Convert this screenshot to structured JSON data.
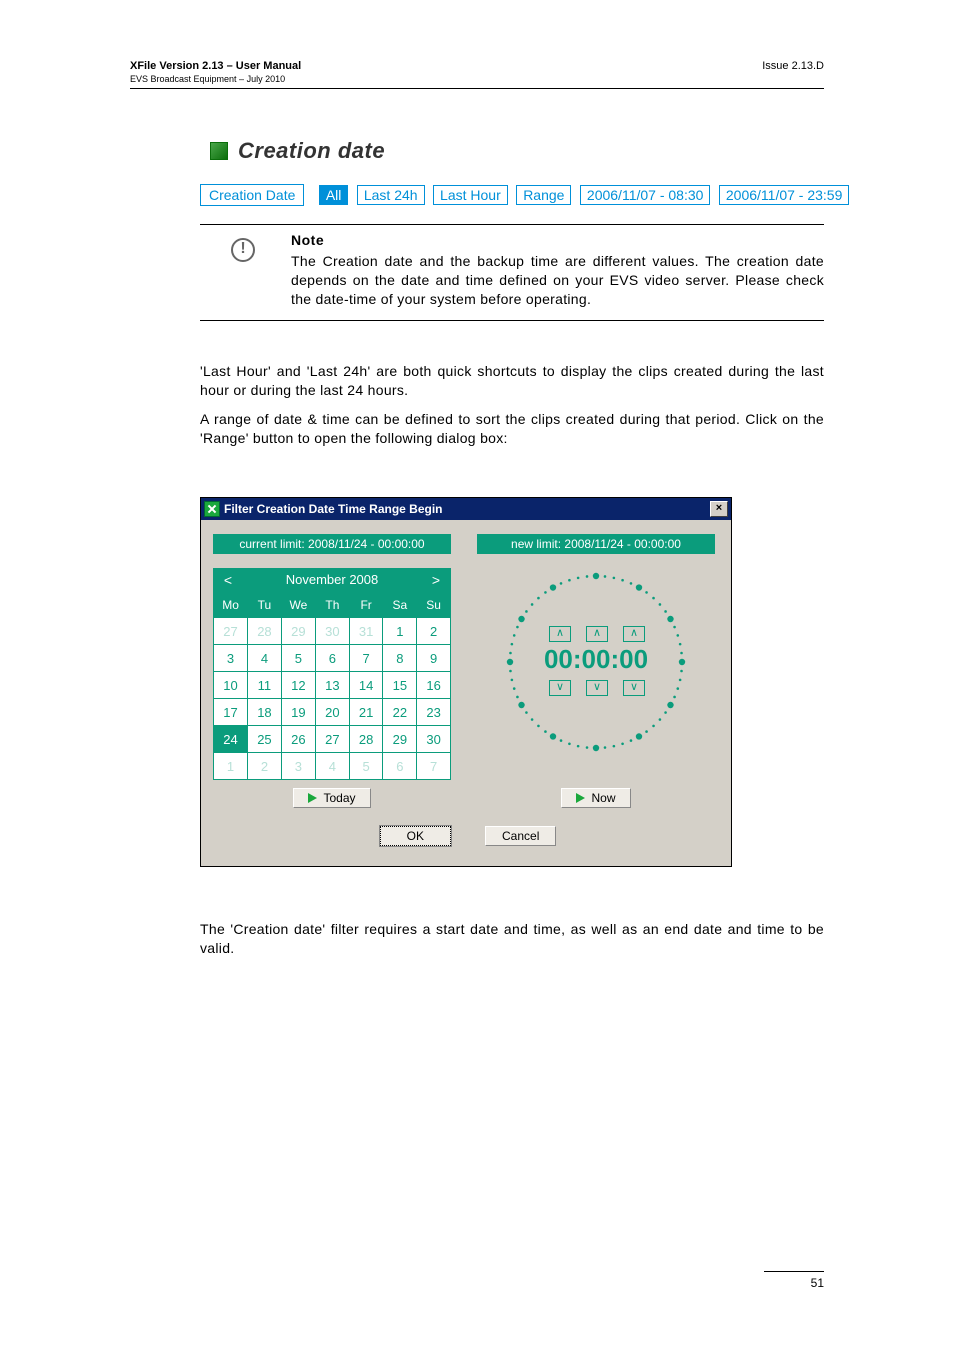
{
  "header": {
    "left_title": "XFile Version 2.13 – User Manual",
    "left_sub": "EVS Broadcast Equipment – July 2010",
    "right": "Issue 2.13.D"
  },
  "section": {
    "title": "Creation date"
  },
  "toolbar": {
    "label": "Creation Date",
    "buttons": {
      "all": "All",
      "last24h": "Last 24h",
      "lasthour": "Last Hour",
      "range": "Range",
      "start": "2006/11/07 - 08:30",
      "end": "2006/11/07 - 23:59"
    }
  },
  "note": {
    "title": "Note",
    "body": "The Creation date and the backup time are different values. The creation date depends on the date and time defined on your EVS video server. Please check the date-time of your system before operating."
  },
  "para1": "'Last Hour' and 'Last 24h' are both quick shortcuts to display the clips created during the last hour or during the last 24 hours.",
  "para2": "A range of date & time can be defined to sort the clips created during that period. Click on the 'Range' button to open the following dialog box:",
  "dialog": {
    "title": "Filter Creation Date Time Range Begin",
    "current_limit": "current limit: 2008/11/24 - 00:00:00",
    "new_limit": "new limit: 2008/11/24 - 00:00:00",
    "month_label": "November 2008",
    "weekdays": [
      "Mo",
      "Tu",
      "We",
      "Th",
      "Fr",
      "Sa",
      "Su"
    ],
    "grid": [
      [
        {
          "d": "27",
          "g": true
        },
        {
          "d": "28",
          "g": true
        },
        {
          "d": "29",
          "g": true
        },
        {
          "d": "30",
          "g": true
        },
        {
          "d": "31",
          "g": true
        },
        {
          "d": "1"
        },
        {
          "d": "2"
        }
      ],
      [
        {
          "d": "3"
        },
        {
          "d": "4"
        },
        {
          "d": "5"
        },
        {
          "d": "6"
        },
        {
          "d": "7"
        },
        {
          "d": "8"
        },
        {
          "d": "9"
        }
      ],
      [
        {
          "d": "10"
        },
        {
          "d": "11"
        },
        {
          "d": "12"
        },
        {
          "d": "13"
        },
        {
          "d": "14"
        },
        {
          "d": "15"
        },
        {
          "d": "16"
        }
      ],
      [
        {
          "d": "17"
        },
        {
          "d": "18"
        },
        {
          "d": "19"
        },
        {
          "d": "20"
        },
        {
          "d": "21"
        },
        {
          "d": "22"
        },
        {
          "d": "23"
        }
      ],
      [
        {
          "d": "24",
          "t": true
        },
        {
          "d": "25"
        },
        {
          "d": "26"
        },
        {
          "d": "27"
        },
        {
          "d": "28"
        },
        {
          "d": "29"
        },
        {
          "d": "30"
        }
      ],
      [
        {
          "d": "1",
          "g": true
        },
        {
          "d": "2",
          "g": true
        },
        {
          "d": "3",
          "g": true
        },
        {
          "d": "4",
          "g": true
        },
        {
          "d": "5",
          "g": true
        },
        {
          "d": "6",
          "g": true
        },
        {
          "d": "7",
          "g": true
        }
      ]
    ],
    "time": "00:00:00",
    "today_btn": "Today",
    "now_btn": "Now",
    "ok": "OK",
    "cancel": "Cancel"
  },
  "para3": "The 'Creation date' filter requires a start date and time, as well as an end date and time to be valid.",
  "page_number": "51",
  "glyphs": {
    "left": "<",
    "right": ">",
    "up": "∧",
    "down": "∨",
    "x": "×"
  }
}
